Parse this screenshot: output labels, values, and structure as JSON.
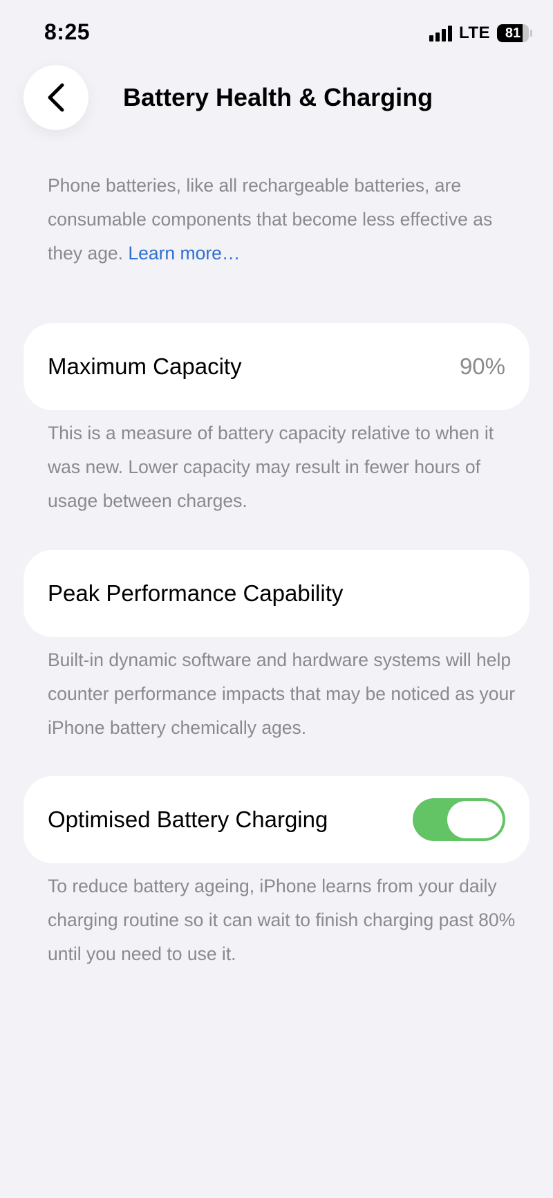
{
  "status_bar": {
    "time": "8:25",
    "network": "LTE",
    "battery_level": "81",
    "battery_fraction": 0.81,
    "signal_bars": 4
  },
  "header": {
    "back_icon": "chevron-left-icon",
    "title": "Battery Health & Charging"
  },
  "intro": {
    "text": "Phone batteries, like all rechargeable batteries, are consumable components that become less effective as they age. ",
    "link": "Learn more…"
  },
  "maximum_capacity": {
    "label": "Maximum Capacity",
    "value": "90%",
    "description": "This is a measure of battery capacity relative to when it was new. Lower capacity may result in fewer hours of usage between charges."
  },
  "peak_performance": {
    "label": "Peak Performance Capability",
    "description": "Built-in dynamic software and hardware systems will help counter performance impacts that may be noticed as your iPhone battery chemically ages."
  },
  "optimised_charging": {
    "label": "Optimised Battery Charging",
    "enabled": true,
    "description": "To reduce battery ageing, iPhone learns from your daily charging routine so it can wait to finish charging past 80% until you need to use it."
  },
  "colors": {
    "background": "#f2f2f7",
    "card": "#ffffff",
    "secondary_text": "#8a8a8e",
    "link": "#2f6fd1",
    "toggle_on": "#63c466"
  }
}
